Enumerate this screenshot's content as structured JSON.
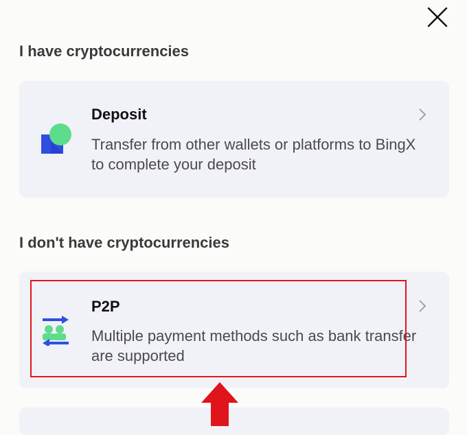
{
  "sections": {
    "have": {
      "title": "I have cryptocurrencies",
      "card": {
        "title": "Deposit",
        "description": "Transfer from other wallets or platforms to BingX to complete your deposit",
        "icon": "deposit-icon"
      }
    },
    "dont_have": {
      "title": "I don't have cryptocurrencies",
      "card": {
        "title": "P2P",
        "description": "Multiple payment methods such as bank transfer are supported",
        "icon": "p2p-icon"
      }
    }
  },
  "colors": {
    "highlight": "#e0141b",
    "card_bg": "#f1f1f8",
    "deposit_blue": "#2f4ee0",
    "deposit_green": "#5ddc8c"
  }
}
